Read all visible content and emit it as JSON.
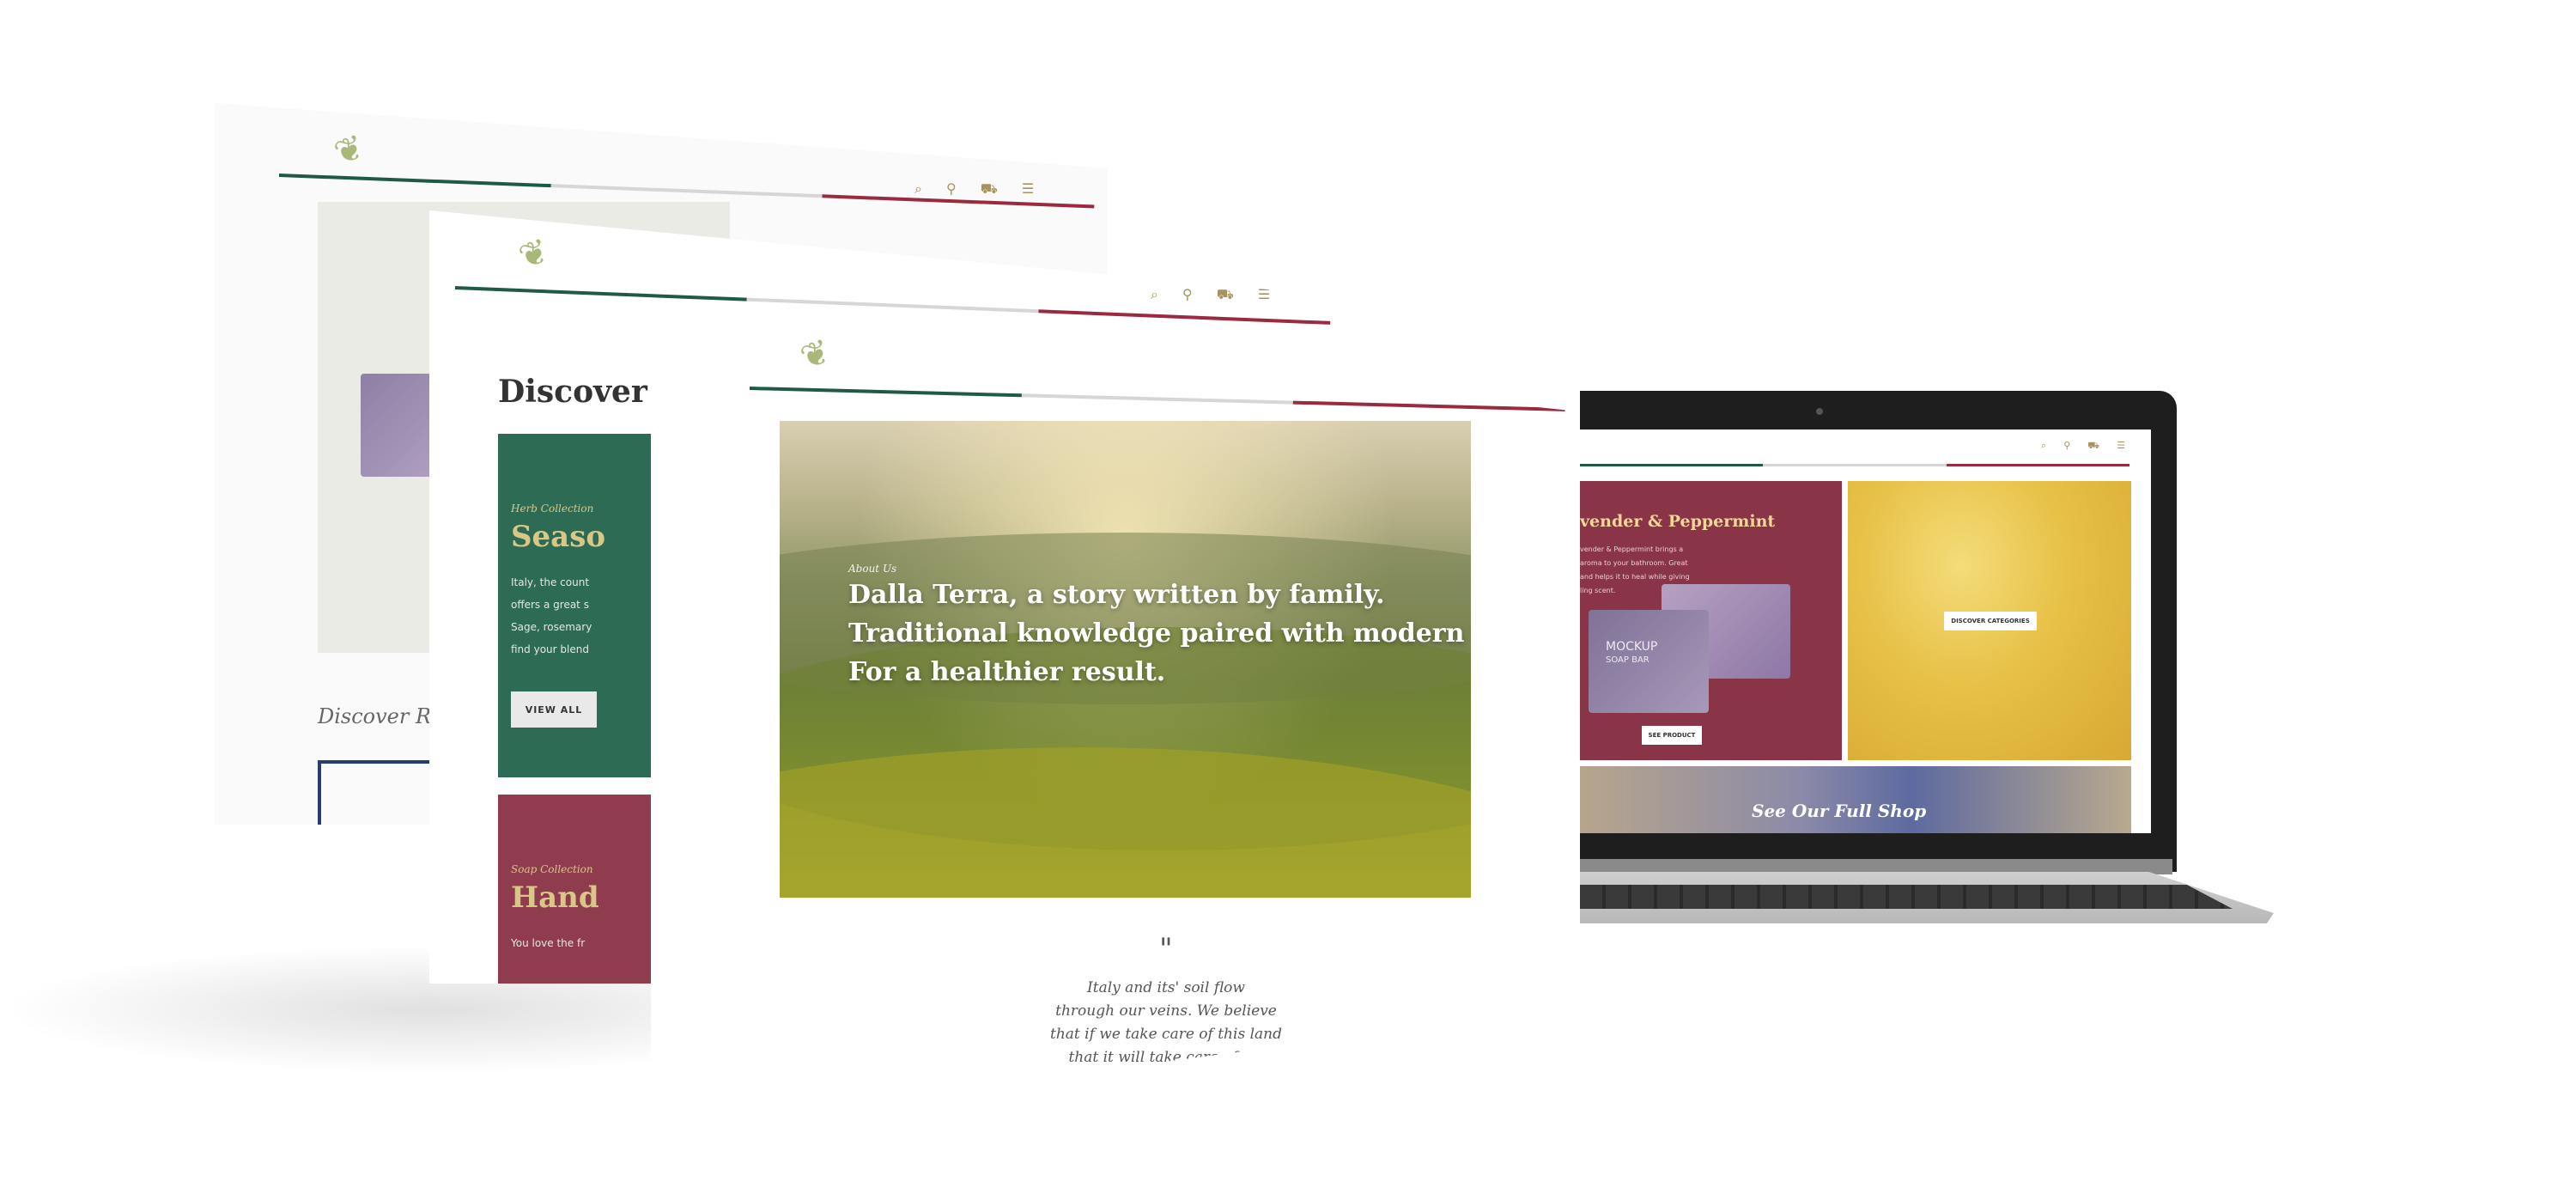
{
  "back_card": {
    "related_heading": "Discover Rela"
  },
  "mid_card": {
    "heading": "Discover Ou",
    "tile1": {
      "eyebrow": "Herb Collection",
      "title": "Seaso",
      "lines": [
        "Italy, the count",
        "offers a great s",
        "Sage, rosemary",
        "find your blend"
      ],
      "button": "VIEW ALL"
    },
    "tile2": {
      "eyebrow": "Soap Collection",
      "title": "Hand",
      "line": "You love the fr"
    }
  },
  "front_card": {
    "eyebrow": "About Us",
    "headline": [
      "Dalla Terra, a story written by family.",
      "Traditional knowledge paired with modern ideas.",
      "For a healthier result."
    ],
    "quote_mark": "\"",
    "quote": [
      "Italy and its' soil flow",
      "through our veins. We believe",
      "that if we take care of this land",
      "that it will take care of us."
    ]
  },
  "laptop": {
    "product_title": "vender & Peppermint",
    "product_text": [
      "vender & Peppermint brings a",
      "aroma to your bathroom. Great",
      "and helps it to heal while giving",
      "ling scent."
    ],
    "soap_label": [
      "MOCKUP",
      "SOAP BAR"
    ],
    "see_product": "SEE PRODUCT",
    "discover_categories": "DISCOVER CATEGORIES",
    "banner_text": "See Our Full Shop"
  },
  "icons": {
    "logo": "olive-branch",
    "search": "⌕",
    "account": "⚲",
    "cart": "⛟",
    "menu": "☰"
  },
  "colors": {
    "accent_green": "#1f5a44",
    "accent_red": "#9c2a3e",
    "gold": "#a7935d",
    "tile_green": "#2e6b54",
    "tile_red": "#8f3c4f"
  }
}
